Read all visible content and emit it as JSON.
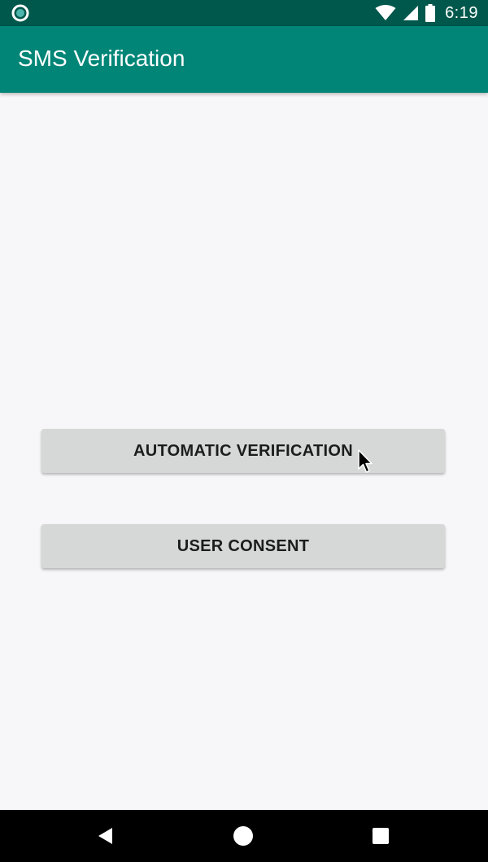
{
  "status_bar": {
    "time": "6:19",
    "left_icon": "circle-notification-icon",
    "icons": [
      "wifi-icon",
      "cell-signal-icon",
      "battery-icon"
    ]
  },
  "app_bar": {
    "title": "SMS Verification",
    "color": "#008577",
    "status_color": "#00574b"
  },
  "main": {
    "buttons": [
      {
        "label": "AUTOMATIC VERIFICATION"
      },
      {
        "label": "USER CONSENT"
      }
    ],
    "background": "#f7f6f8"
  },
  "nav_bar": {
    "icons": [
      "back-icon",
      "home-icon",
      "recents-icon"
    ]
  }
}
